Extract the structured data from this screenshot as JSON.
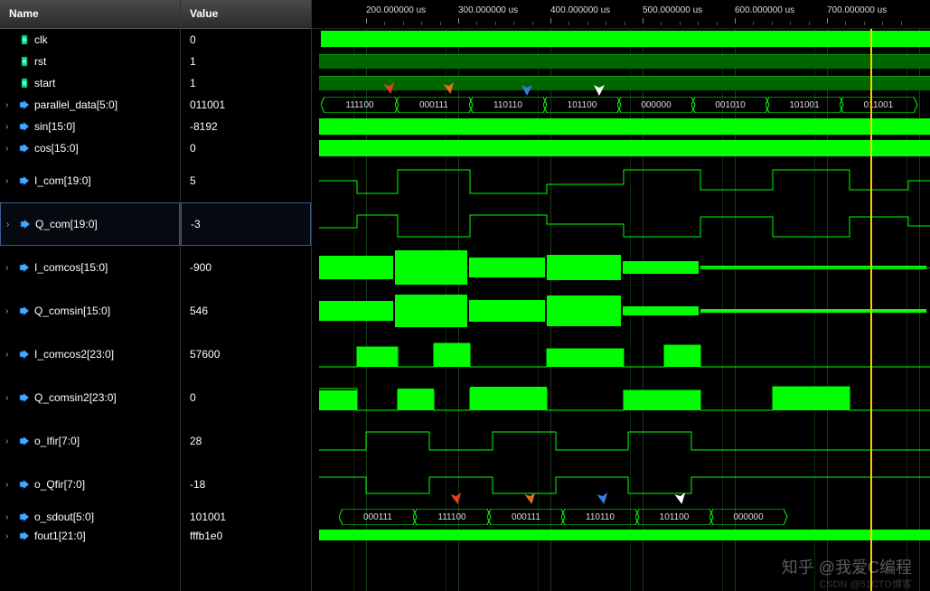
{
  "headers": {
    "name": "Name",
    "value": "Value"
  },
  "ruler_ticks": [
    "200.000000 us",
    "300.000000 us",
    "400.000000 us",
    "500.000000 us",
    "600.000000 us",
    "700.000000 us"
  ],
  "signals": [
    {
      "name": "clk",
      "value": "0",
      "icon": "wire",
      "expandable": false,
      "height": 24
    },
    {
      "name": "rst",
      "value": "1",
      "icon": "wire",
      "expandable": false,
      "height": 24
    },
    {
      "name": "start",
      "value": "1",
      "icon": "wire",
      "expandable": false,
      "height": 24
    },
    {
      "name": "parallel_data[5:0]",
      "value": "011001",
      "icon": "bus",
      "expandable": true,
      "height": 24
    },
    {
      "name": "sin[15:0]",
      "value": "-8192",
      "icon": "bus",
      "expandable": true,
      "height": 24
    },
    {
      "name": "cos[15:0]",
      "value": "0",
      "icon": "bus",
      "expandable": true,
      "height": 24
    },
    {
      "name": "I_com[19:0]",
      "value": "5",
      "icon": "bus",
      "expandable": true,
      "height": 48
    },
    {
      "name": "Q_com[19:0]",
      "value": "-3",
      "icon": "bus",
      "expandable": true,
      "height": 48,
      "selected": true
    },
    {
      "name": "I_comcos[15:0]",
      "value": "-900",
      "icon": "bus",
      "expandable": true,
      "height": 48
    },
    {
      "name": "Q_comsin[15:0]",
      "value": "546",
      "icon": "bus",
      "expandable": true,
      "height": 48
    },
    {
      "name": "I_comcos2[23:0]",
      "value": "57600",
      "icon": "bus",
      "expandable": true,
      "height": 48
    },
    {
      "name": "Q_comsin2[23:0]",
      "value": "0",
      "icon": "bus",
      "expandable": true,
      "height": 48
    },
    {
      "name": "o_Ifir[7:0]",
      "value": "28",
      "icon": "bus",
      "expandable": true,
      "height": 48
    },
    {
      "name": "o_Qfir[7:0]",
      "value": "-18",
      "icon": "bus",
      "expandable": true,
      "height": 48
    },
    {
      "name": "o_sdout[5:0]",
      "value": "101001",
      "icon": "bus",
      "expandable": true,
      "height": 24
    },
    {
      "name": "fout1[21:0]",
      "value": "fffb1e0",
      "icon": "bus",
      "expandable": true,
      "height": 18
    }
  ],
  "bus_top": [
    "111100",
    "000111",
    "110110",
    "101100",
    "000000",
    "001010",
    "101001",
    "011001"
  ],
  "bus_bottom": [
    "000111",
    "111100",
    "000111",
    "110110",
    "101100",
    "000000"
  ],
  "watermark": "知乎 @我爱C编程",
  "watermark_small": "CSDN @51CTO博客"
}
